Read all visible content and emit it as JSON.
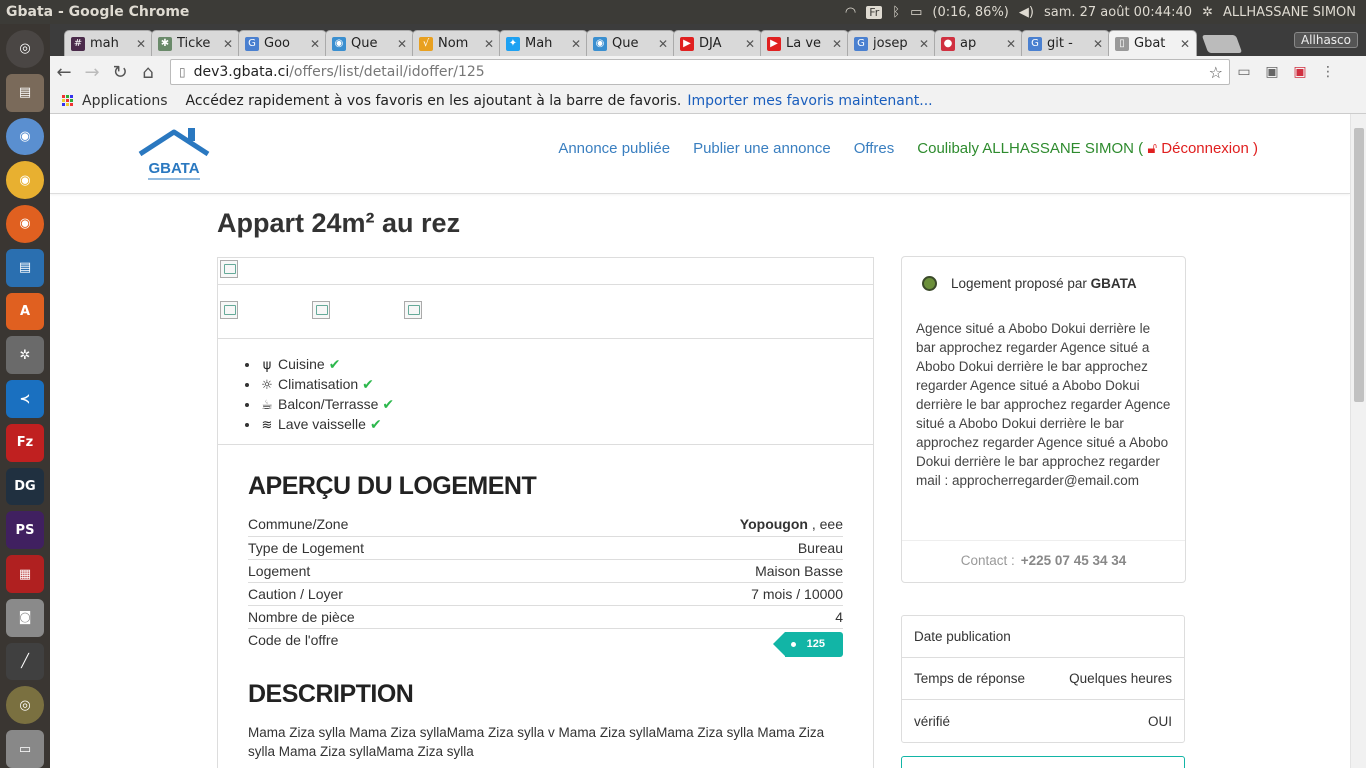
{
  "os": {
    "window_title": "Gbata - Google Chrome",
    "lang": "Fr",
    "battery": "(0:16, 86%)",
    "datetime": "sam. 27 août 00:44:40",
    "user": "ALLHASSANE SIMON"
  },
  "browser": {
    "tabs": [
      {
        "label": "mah",
        "color": "#4a2a4a",
        "glyph": "#"
      },
      {
        "label": "Ticke",
        "color": "#6a8a6a",
        "glyph": "✱"
      },
      {
        "label": "Goo",
        "color": "#4a80d0",
        "glyph": "G"
      },
      {
        "label": "Que",
        "color": "#3a8fd0",
        "glyph": "◉"
      },
      {
        "label": "Nom",
        "color": "#e8a020",
        "glyph": "√"
      },
      {
        "label": "Mah",
        "color": "#1da1f2",
        "glyph": "✦"
      },
      {
        "label": "Que",
        "color": "#3a8fd0",
        "glyph": "◉"
      },
      {
        "label": "DJA",
        "color": "#e02020",
        "glyph": "▶"
      },
      {
        "label": "La ve",
        "color": "#e02020",
        "glyph": "▶"
      },
      {
        "label": "josep",
        "color": "#4a80d0",
        "glyph": "G"
      },
      {
        "label": "ap",
        "color": "#d03040",
        "glyph": "●"
      },
      {
        "label": "git -",
        "color": "#4a80d0",
        "glyph": "G"
      },
      {
        "label": "Gbat",
        "color": "#999999",
        "glyph": "▯"
      }
    ],
    "profile": "Allhasco",
    "url_host": "dev3.gbata.ci",
    "url_path": "/offers/list/detail/idoffer/125",
    "bookmarks_apps": "Applications",
    "bookmarks_hint": "Accédez rapidement à vos favoris en les ajoutant à la barre de favoris.",
    "bookmarks_link": "Importer mes favoris maintenant..."
  },
  "site": {
    "logo_text": "GBATA",
    "nav": {
      "published": "Annonce publiée",
      "publish": "Publier une annonce",
      "offers": "Offres",
      "user": "Coulibaly ALLHASSANE SIMON (",
      "logout": "Déconnexion )"
    }
  },
  "offer": {
    "title": "Appart 24m² au rez",
    "amenities": [
      {
        "icon": "utensils-icon",
        "label": "Cuisine"
      },
      {
        "icon": "sun-icon",
        "label": "Climatisation"
      },
      {
        "icon": "coffee-icon",
        "label": "Balcon/Terrasse"
      },
      {
        "icon": "database-icon",
        "label": "Lave vaisselle"
      }
    ],
    "overview_title": "APERÇU DU LOGEMENT",
    "specs": {
      "commune_label": "Commune/Zone",
      "commune_city": "Yopougon",
      "commune_zone": " , eee",
      "type_label": "Type de Logement",
      "type_value": "Bureau",
      "housing_label": "Logement",
      "housing_value": "Maison Basse",
      "rent_label": "Caution / Loyer",
      "rent_value": "7 mois / 10000",
      "rooms_label": "Nombre de pièce",
      "rooms_value": "4",
      "code_label": "Code de l'offre",
      "code_value": "125"
    },
    "description_title": "DESCRIPTION",
    "description_text": "Mama Ziza sylla Mama Ziza syllaMama Ziza sylla v Mama Ziza syllaMama Ziza sylla Mama Ziza sylla Mama Ziza syllaMama Ziza sylla"
  },
  "agency": {
    "header_prefix": "Logement proposé par ",
    "name": "GBATA",
    "description": "Agence situé a Abobo Dokui derrière le bar approchez regarder Agence situé a Abobo Dokui derrière le bar approchez regarder Agence situé a Abobo Dokui derrière le bar approchez regarder Agence situé a Abobo Dokui derrière le bar approchez regarder Agence situé a Abobo Dokui derrière le bar approchez regarder",
    "mail": "mail : approcherregarder@email.com",
    "contact_label": "Contact :",
    "contact_number": "+225 07 45 34 34"
  },
  "info": {
    "pub_label": "Date publication",
    "pub_value": "",
    "response_label": "Temps de réponse",
    "response_value": "Quelques heures",
    "verified_label": "vérifié",
    "verified_value": "OUI"
  }
}
